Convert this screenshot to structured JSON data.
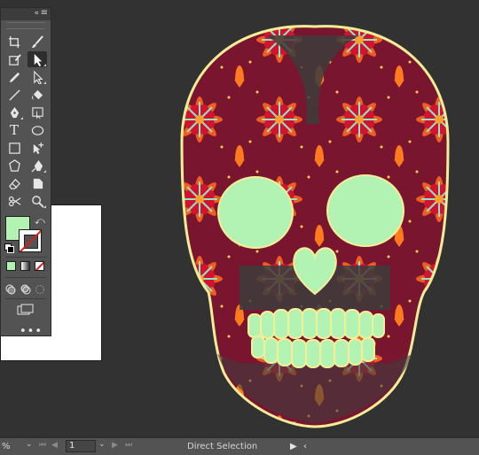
{
  "app": {
    "colors": {
      "canvas": "#323232",
      "panel": "#535353",
      "fill": "#b2f2b3",
      "skull_outline": "#f5ee97",
      "flower_red": "#c21e3a",
      "flower_orange": "#f25c1f",
      "teeth": "#b2f2b3"
    }
  },
  "toolbar": {
    "collapse_icon": "«",
    "menu_icon": "≡",
    "tools": [
      {
        "name": "artboard-tool-icon"
      },
      {
        "name": "paintbrush-tool-icon"
      },
      {
        "name": "edit-toolbar-icon"
      },
      {
        "name": "selection-arrow-icon"
      },
      {
        "name": "pencil-tool-icon"
      },
      {
        "name": "direct-selection-icon"
      },
      {
        "name": "line-tool-icon"
      },
      {
        "name": "live-paint-bucket-icon"
      },
      {
        "name": "pen-tool-icon"
      },
      {
        "name": "transform-tool-icon"
      },
      {
        "name": "type-tool-icon"
      },
      {
        "name": "ellipse-tool-icon"
      },
      {
        "name": "rectangle-tool-icon"
      },
      {
        "name": "anchor-add-icon"
      },
      {
        "name": "polygon-tool-icon"
      },
      {
        "name": "anchor-convert-icon"
      },
      {
        "name": "eraser-tool-icon"
      },
      {
        "name": "shape-builder-icon"
      },
      {
        "name": "scissors-tool-icon"
      },
      {
        "name": "zoom-tool-icon"
      }
    ],
    "type_glyph": "T",
    "more_label": "•••"
  },
  "statusbar": {
    "zoom_value": "%",
    "artboard_number": "1",
    "tool_name": "Direct Selection"
  }
}
